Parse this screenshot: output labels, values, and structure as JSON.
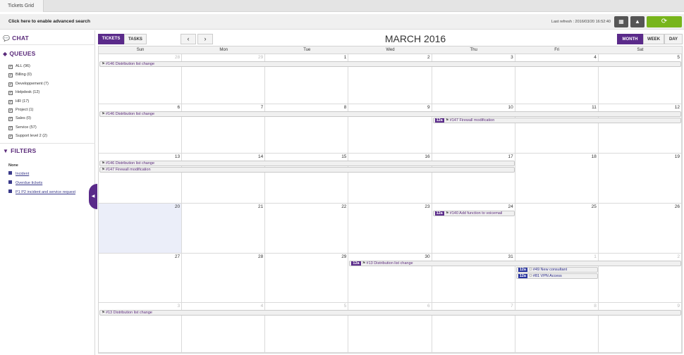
{
  "tab_title": "Tickets Grid",
  "toolbar": {
    "advanced_search": "Click here to enable advanced search",
    "last_refresh": "Last refresh : 2016/03/20 16:52:40"
  },
  "sidebar": {
    "chat": "CHAT",
    "queues_title": "QUEUES",
    "queues": [
      "ALL (96)",
      "Billing (0)",
      "Developpement (7)",
      "Helpdesk (12)",
      "HR (17)",
      "Project (1)",
      "Sales (0)",
      "Service (57)",
      "Support level 2 (2)"
    ],
    "filters_title": "FILTERS",
    "filter_none": "None",
    "filters": [
      "Incident",
      "Overdue tickets",
      "P1 P2 incident and service request"
    ]
  },
  "calendar": {
    "tickets": "TICKETS",
    "tasks": "TASKS",
    "prev": "‹",
    "next": "›",
    "title": "MARCH 2016",
    "views": [
      "MONTH",
      "WEEK",
      "DAY"
    ],
    "days_of_week": [
      "Sun",
      "Mon",
      "Tue",
      "Wed",
      "Thu",
      "Fri",
      "Sat"
    ],
    "weeks": [
      [
        [
          "28",
          true
        ],
        [
          "29",
          true
        ],
        [
          "1",
          false
        ],
        [
          "2",
          false
        ],
        [
          "3",
          false
        ],
        [
          "4",
          false
        ],
        [
          "5",
          false
        ]
      ],
      [
        [
          "6",
          false
        ],
        [
          "7",
          false
        ],
        [
          "8",
          false
        ],
        [
          "9",
          false
        ],
        [
          "10",
          false
        ],
        [
          "11",
          false
        ],
        [
          "12",
          false
        ]
      ],
      [
        [
          "13",
          false
        ],
        [
          "14",
          false
        ],
        [
          "15",
          false
        ],
        [
          "16",
          false
        ],
        [
          "17",
          false
        ],
        [
          "18",
          false
        ],
        [
          "19",
          false
        ]
      ],
      [
        [
          "20",
          false
        ],
        [
          "21",
          false
        ],
        [
          "22",
          false
        ],
        [
          "23",
          false
        ],
        [
          "24",
          false
        ],
        [
          "25",
          false
        ],
        [
          "26",
          false
        ]
      ],
      [
        [
          "27",
          false
        ],
        [
          "28",
          false
        ],
        [
          "29",
          false
        ],
        [
          "30",
          false
        ],
        [
          "31",
          false
        ],
        [
          "1",
          true
        ],
        [
          "2",
          true
        ]
      ],
      [
        [
          "3",
          true
        ],
        [
          "4",
          true
        ],
        [
          "5",
          true
        ],
        [
          "6",
          true
        ],
        [
          "7",
          true
        ],
        [
          "8",
          true
        ],
        [
          "9",
          true
        ]
      ]
    ],
    "events": [
      {
        "week": 0,
        "start": 0,
        "end": 7,
        "slot": 0,
        "label": "#146 Distribution list change"
      },
      {
        "week": 1,
        "start": 0,
        "end": 7,
        "slot": 0,
        "label": "#146 Distribution list change"
      },
      {
        "week": 1,
        "start": 4,
        "end": 7,
        "slot": 1,
        "label": "#147 Firewall modification",
        "time": "12a"
      },
      {
        "week": 2,
        "start": 0,
        "end": 5,
        "slot": 0,
        "label": "#146 Distribution list change"
      },
      {
        "week": 2,
        "start": 0,
        "end": 5,
        "slot": 1,
        "label": "#147 Firewall modification"
      },
      {
        "week": 3,
        "start": 4,
        "end": 5,
        "slot": 0,
        "label": "#140 Add function to voicemail",
        "time": "12a"
      },
      {
        "week": 4,
        "start": 3,
        "end": 7,
        "slot": 0,
        "label": "#13 Distribution list change",
        "time": "12a"
      },
      {
        "week": 4,
        "start": 5,
        "end": 6,
        "slot": 1,
        "label": "#49 New consultant",
        "time": "12a",
        "color": "blue"
      },
      {
        "week": 4,
        "start": 5,
        "end": 6,
        "slot": 2,
        "label": "#81 VPN Access",
        "time": "12a",
        "color": "blue"
      },
      {
        "week": 5,
        "start": 0,
        "end": 7,
        "slot": 0,
        "label": "#13 Distribution list change"
      }
    ]
  }
}
